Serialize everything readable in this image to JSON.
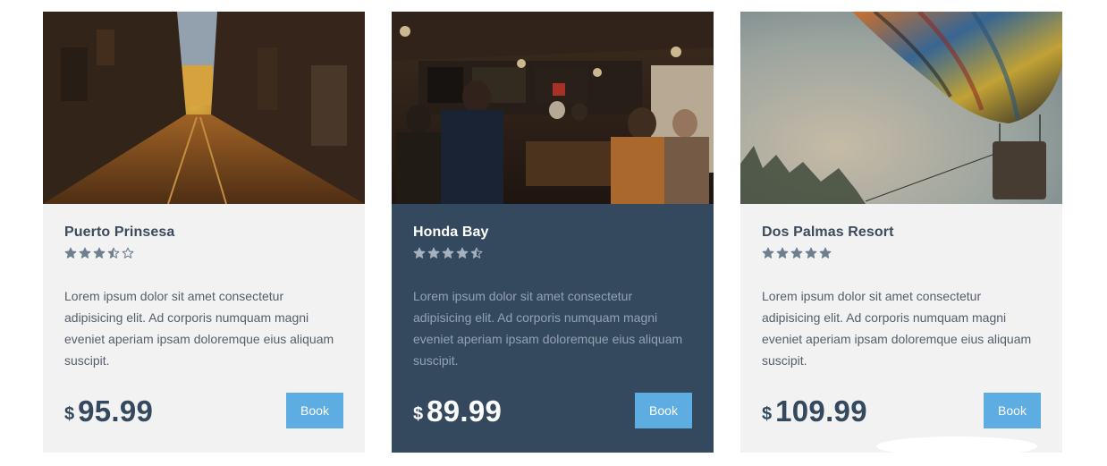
{
  "cards": [
    {
      "title": "Puerto Prinsesa",
      "image": "city-street-sunset-photo",
      "rating": 3.5,
      "description": "Lorem ipsum dolor sit amet consectetur adipisicing elit. Ad corporis numquam magni eveniet aperiam ipsam doloremque eius aliquam suscipit.",
      "currency": "$",
      "price": "95.99",
      "button_label": "Book"
    },
    {
      "title": "Honda Bay",
      "image": "crowded-bar-interior-photo",
      "rating": 4.5,
      "description": "Lorem ipsum dolor sit amet consectetur adipisicing elit. Ad corporis numquam magni eveniet aperiam ipsam doloremque eius aliquam suscipit.",
      "currency": "$",
      "price": "89.99",
      "button_label": "Book"
    },
    {
      "title": "Dos Palmas Resort",
      "image": "hot-air-balloon-photo",
      "rating": 5,
      "description": "Lorem ipsum dolor sit amet consectetur adipisicing elit. Ad corporis numquam magni eveniet aperiam ipsam doloremque eius aliquam suscipit.",
      "currency": "$",
      "price": "109.99",
      "button_label": "Book"
    }
  ],
  "colors": {
    "card_bg": "#f2f2f2",
    "featured_bg": "#34495e",
    "accent": "#5dade2",
    "star": "#6f7f91",
    "star_featured": "#a5b1bf"
  }
}
